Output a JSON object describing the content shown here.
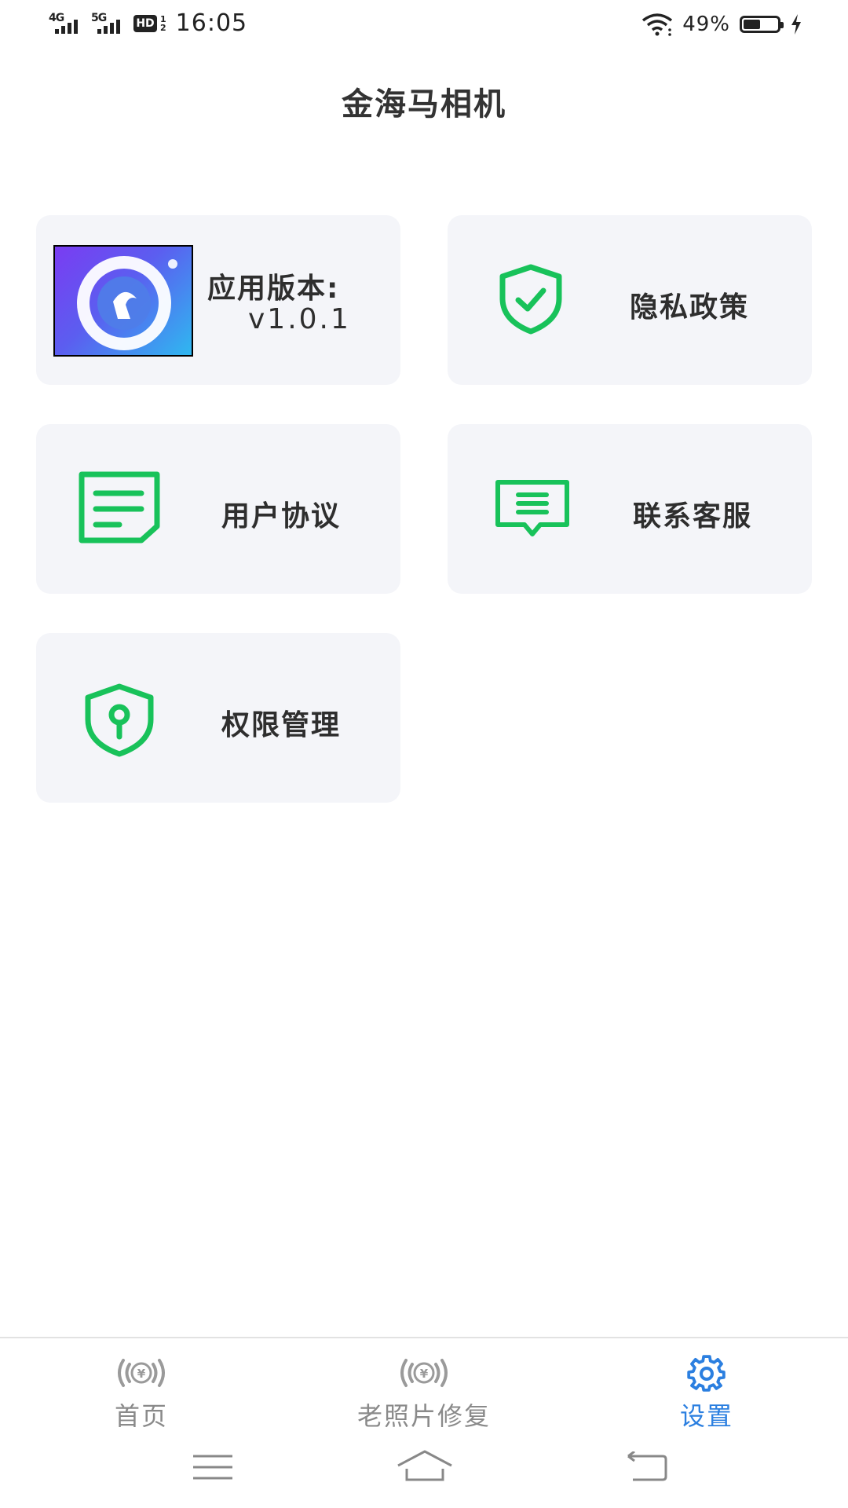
{
  "status_bar": {
    "network1": "4G",
    "network2": "5G",
    "hd": "HD",
    "hd_sub_top": "1",
    "hd_sub_bottom": "2",
    "time": "16:05",
    "battery_percent": "49%",
    "battery_level": 0.49
  },
  "header": {
    "title": "金海马相机"
  },
  "cards": {
    "version": {
      "label": "应用版本:",
      "value": "v1.0.1"
    },
    "privacy": {
      "label": "隐私政策",
      "icon": "shield-check-icon"
    },
    "agreement": {
      "label": "用户协议",
      "icon": "document-icon"
    },
    "support": {
      "label": "联系客服",
      "icon": "chat-message-icon"
    },
    "permissions": {
      "label": "权限管理",
      "icon": "shield-keyhole-icon"
    }
  },
  "bottom_nav": {
    "items": [
      {
        "label": "首页",
        "icon": "broadcast-yen-icon",
        "active": false
      },
      {
        "label": "老照片修复",
        "icon": "broadcast-yen-icon",
        "active": false
      },
      {
        "label": "设置",
        "icon": "gear-icon",
        "active": true
      }
    ]
  },
  "colors": {
    "accent_green": "#18c25a",
    "active_blue": "#2b7fe0",
    "card_bg": "#f4f5f9"
  }
}
